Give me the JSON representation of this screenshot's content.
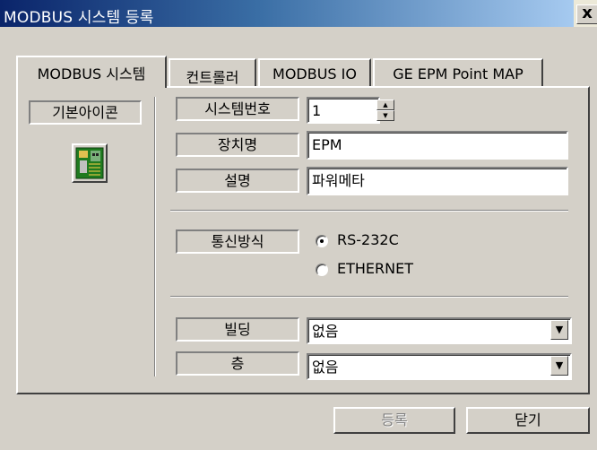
{
  "window": {
    "title": "MODBUS 시스템 등록",
    "close_glyph": "x"
  },
  "tabs": [
    {
      "label": "MODBUS 시스템",
      "active": true
    },
    {
      "label": "컨트롤러",
      "active": false
    },
    {
      "label": "MODBUS IO",
      "active": false
    },
    {
      "label": "GE EPM Point MAP",
      "active": false
    }
  ],
  "left": {
    "icon_label": "기본아이콘",
    "icon": "circuit-board-icon"
  },
  "fields": {
    "system_no_label": "시스템번호",
    "system_no_value": "1",
    "device_label": "장치명",
    "device_value": "EPM",
    "desc_label": "설명",
    "desc_value": "파워메타"
  },
  "comm": {
    "label": "통신방식",
    "options": [
      {
        "label": "RS-232C",
        "selected": true
      },
      {
        "label": "ETHERNET",
        "selected": false
      }
    ]
  },
  "location": {
    "building_label": "빌딩",
    "building_value": "없음",
    "floor_label": "층",
    "floor_value": "없음"
  },
  "buttons": {
    "register": "등록",
    "close": "닫기"
  },
  "colors": {
    "title_start": "#0a246a",
    "title_end": "#a6caf0",
    "face": "#d4d0c8",
    "board_green": "#2a8a2a"
  }
}
